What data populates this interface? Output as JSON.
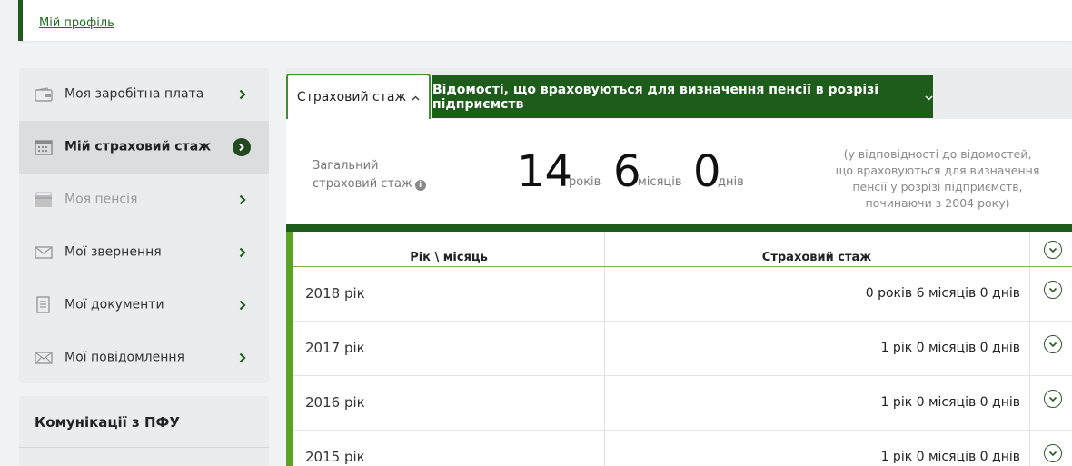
{
  "header": {
    "profile_link": "Мій профіль"
  },
  "sidebar": {
    "items": [
      {
        "label": "Моя заробітна плата",
        "icon": "wallet-icon",
        "state": "normal"
      },
      {
        "label": "Мій страховий стаж",
        "icon": "calendar-icon",
        "state": "active"
      },
      {
        "label": "Моя пенсія",
        "icon": "folder-icon",
        "state": "muted"
      },
      {
        "label": "Мої звернення",
        "icon": "envelope-icon",
        "state": "normal"
      },
      {
        "label": "Мої документи",
        "icon": "document-icon",
        "state": "normal"
      },
      {
        "label": "Мої повідомлення",
        "icon": "mail-icon",
        "state": "normal"
      }
    ]
  },
  "communications": {
    "title": "Комунікації з ПФУ"
  },
  "tabs": {
    "tab1_label": "Страховий стаж",
    "tab2_label": "Відомості, що враховуються для визначення пенсії в розрізі підприємств"
  },
  "summary": {
    "label_line1": "Загальний",
    "label_line2": "страховий стаж",
    "years_value": "14",
    "years_unit": "років",
    "months_value": "6",
    "months_unit": "місяців",
    "days_value": "0",
    "days_unit": "днів",
    "note": "(у відповідності до відомостей, що враховуються для визначення пенсії у розрізі підприємств, починаючи з 2004 року)"
  },
  "table": {
    "col_year": "Рік \\ місяць",
    "col_stazh": "Страховий стаж",
    "rows": [
      {
        "year": "2018 рік",
        "value": "0 років 6 місяців 0 днів"
      },
      {
        "year": "2017 рік",
        "value": "1 рік 0 місяців 0 днів"
      },
      {
        "year": "2016 рік",
        "value": "1 рік 0 місяців 0 днів"
      },
      {
        "year": "2015 рік",
        "value": "1 рік 0 місяців 0 днів"
      }
    ]
  },
  "colors": {
    "primary_green": "#1e5c1c",
    "accent_green": "#5aa321",
    "tab_border": "#3f8f2a"
  }
}
